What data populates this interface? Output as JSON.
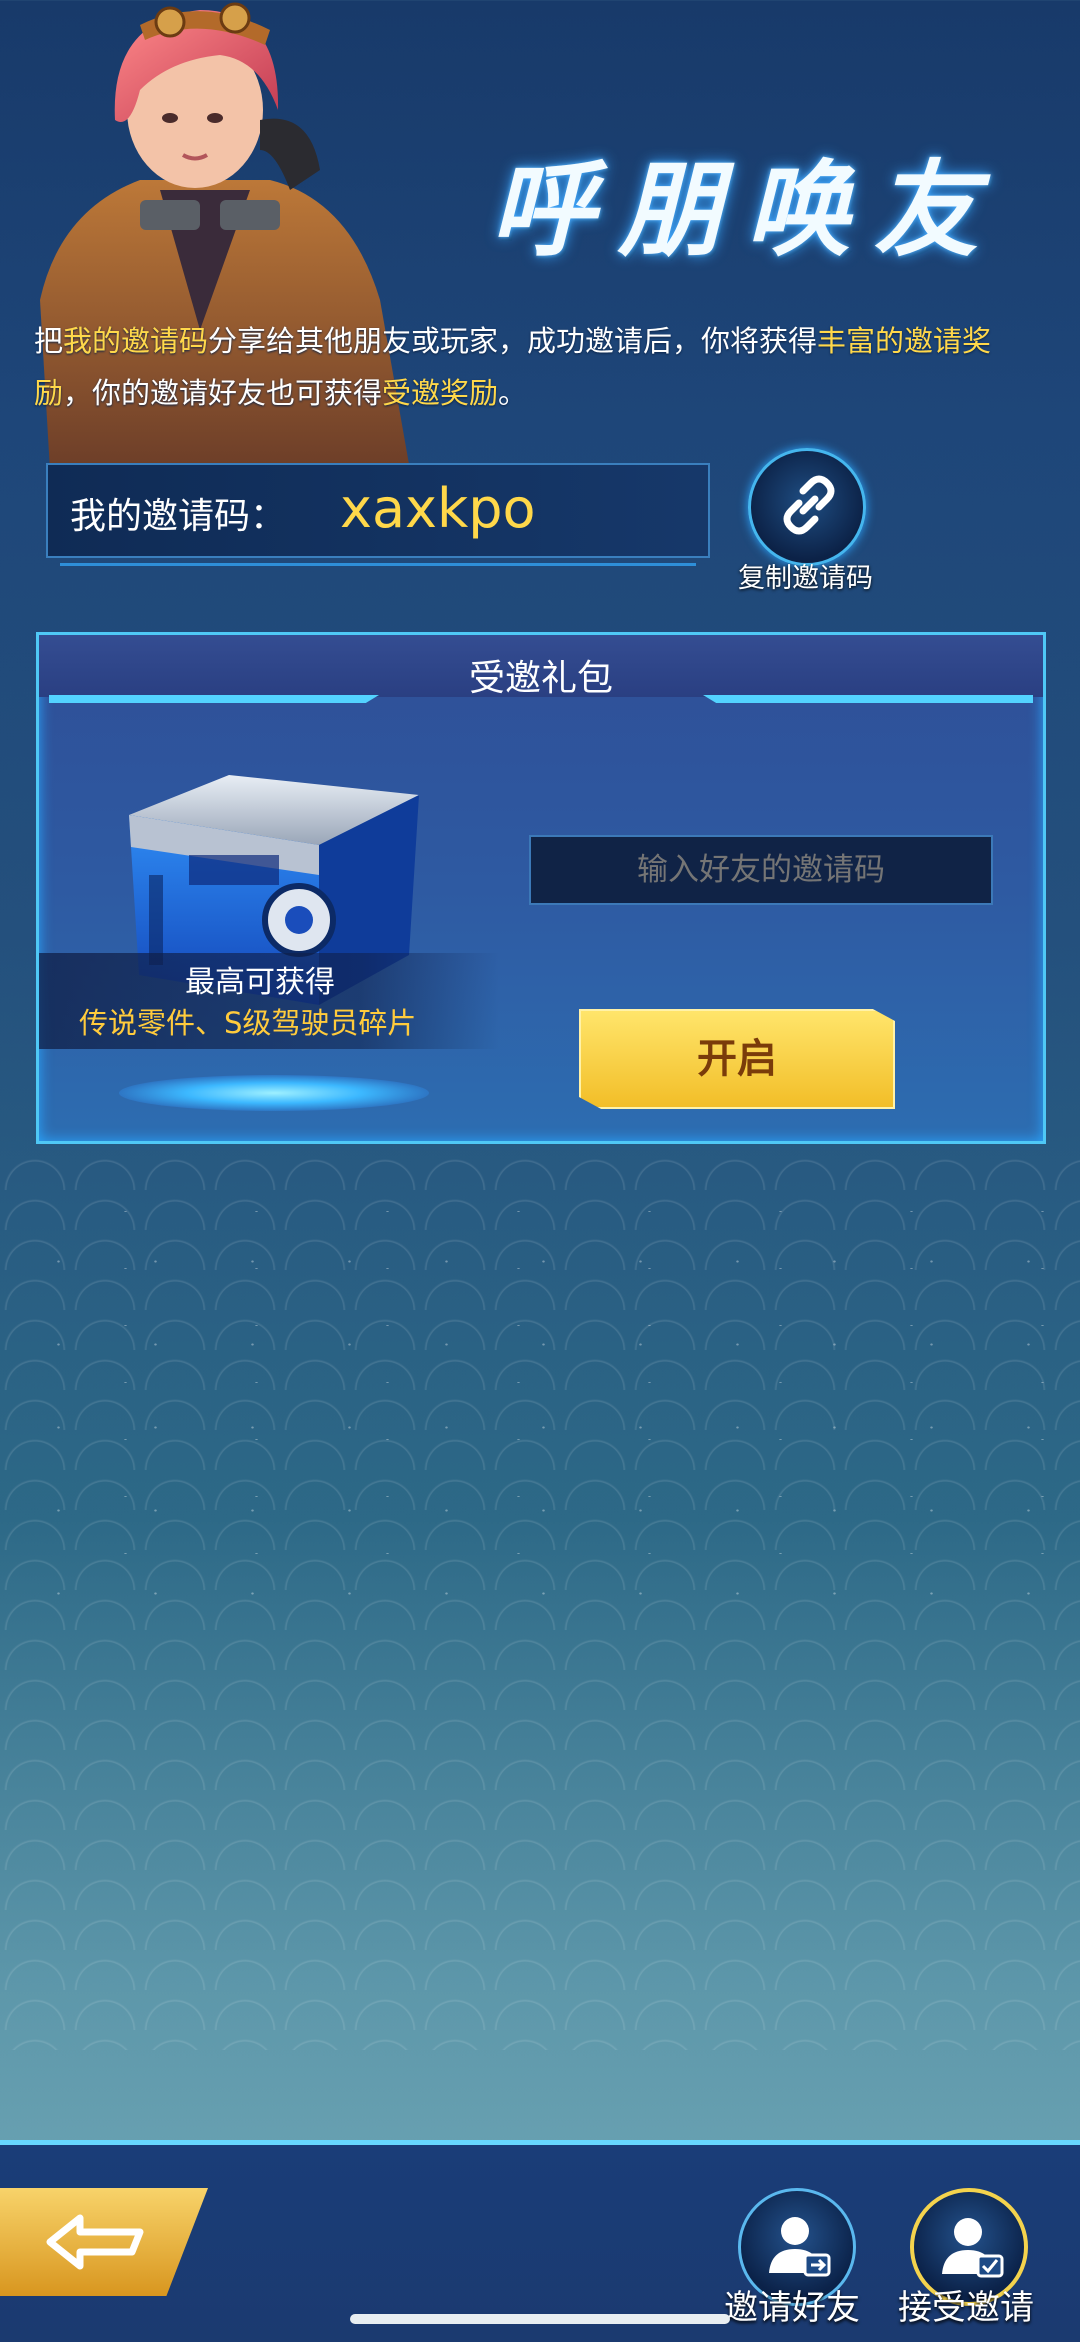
{
  "header": {
    "title": "呼朋唤友"
  },
  "description": {
    "part1": "把",
    "hl1": "我的邀请码",
    "part2": "分享给其他朋友或玩家，成功邀请后，你将获得",
    "hl2": "丰富的邀请奖励",
    "part3": "，你的邀请好友也可获得",
    "hl3": "受邀奖励",
    "part4": "。"
  },
  "my_code": {
    "label": "我的邀请码：",
    "value": "xaxkpo",
    "copy_label": "复制邀请码"
  },
  "gift_panel": {
    "title": "受邀礼包",
    "reward_title": "最高可获得",
    "reward_items": "传说零件、S级驾驶员碎片",
    "input_placeholder": "输入好友的邀请码",
    "open_label": "开启"
  },
  "bottom_nav": {
    "invite_friends": "邀请好友",
    "accept_invite": "接受邀请"
  },
  "colors": {
    "highlight": "#ffd84a",
    "accent": "#4fc8f6",
    "button": "#f2be28"
  },
  "icons": [
    "link-icon",
    "back-icon",
    "invite-user-icon",
    "accept-user-icon"
  ]
}
